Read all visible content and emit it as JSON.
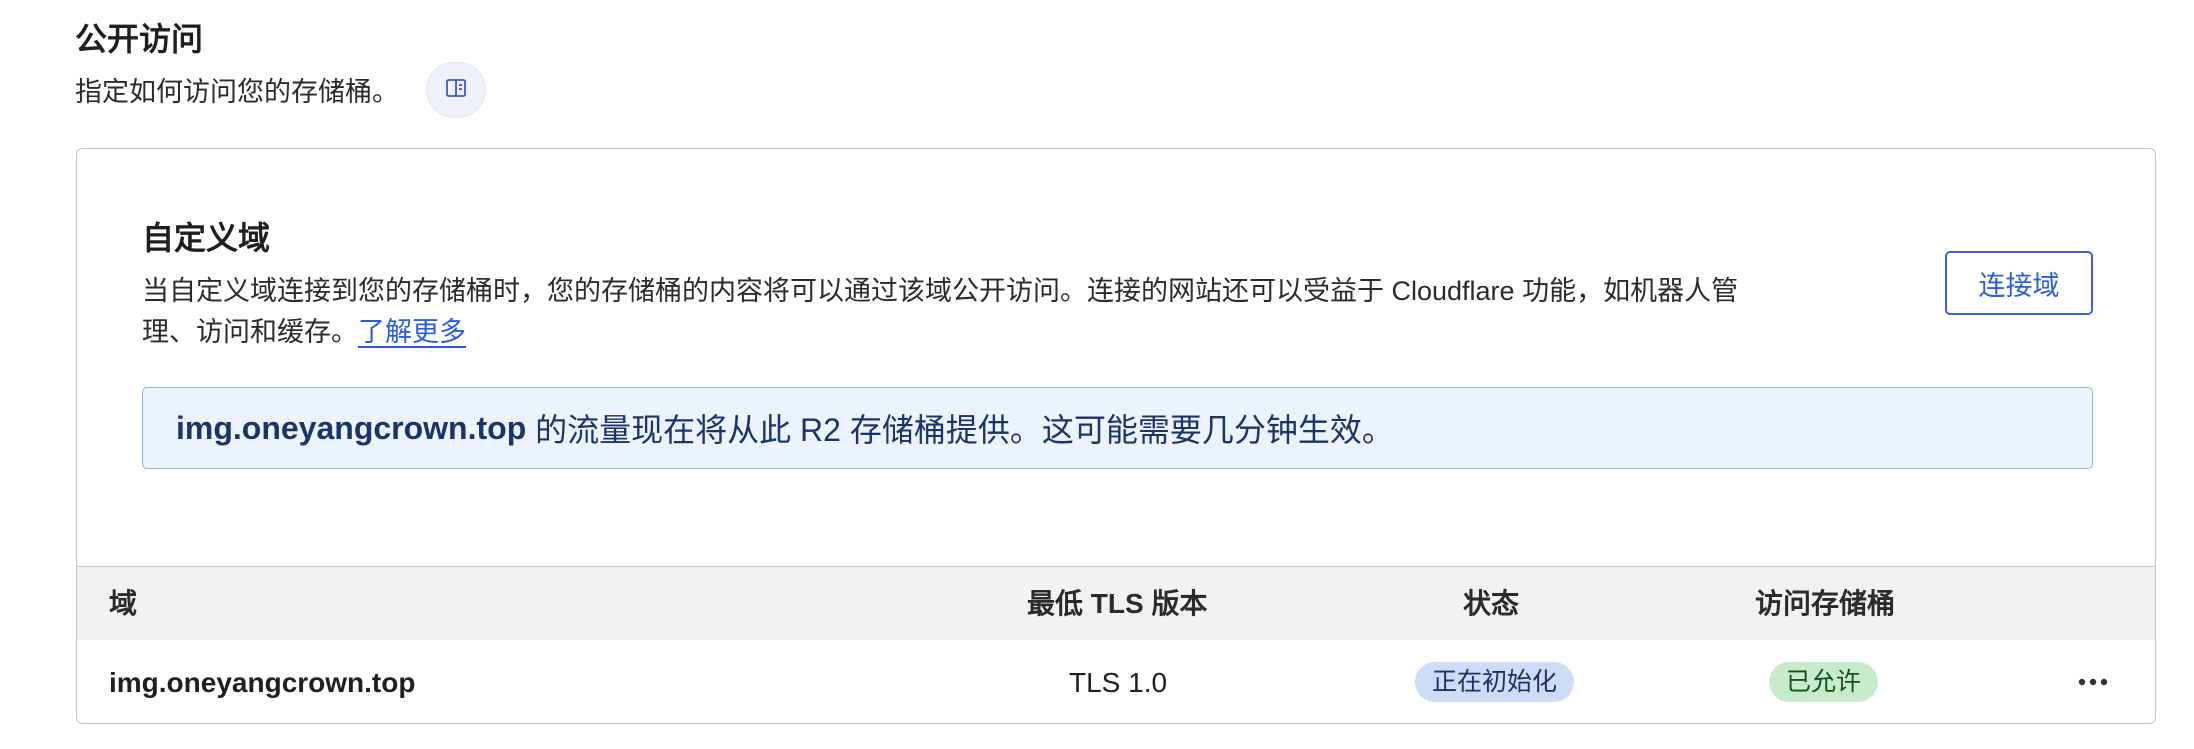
{
  "section": {
    "title": "公开访问",
    "description": "指定如何访问您的存储桶。"
  },
  "custom_domain": {
    "title": "自定义域",
    "description": "当自定义域连接到您的存储桶时，您的存储桶的内容将可以通过该域公开访问。连接的网站还可以受益于 Cloudflare 功能，如机器人管理、访问和缓存。",
    "learn_more": "了解更多",
    "connect_button": "连接域",
    "notice": {
      "domain": "img.oneyangcrown.top",
      "message": " 的流量现在将从此 R2 存储桶提供。这可能需要几分钟生效。"
    }
  },
  "table": {
    "headers": {
      "domain": "域",
      "min_tls": "最低 TLS 版本",
      "status": "状态",
      "access": "访问存储桶"
    },
    "rows": [
      {
        "domain": "img.oneyangcrown.top",
        "min_tls": "TLS 1.0",
        "status": "正在初始化",
        "access": "已允许"
      }
    ]
  },
  "icons": {
    "docs": "book-icon",
    "more": "more-options-icon"
  },
  "colors": {
    "accent": "#2c5fd5",
    "notice_bg": "#edf3fd",
    "status_initializing_bg": "#cfdcf7",
    "access_allowed_bg": "#c7ebcb"
  }
}
